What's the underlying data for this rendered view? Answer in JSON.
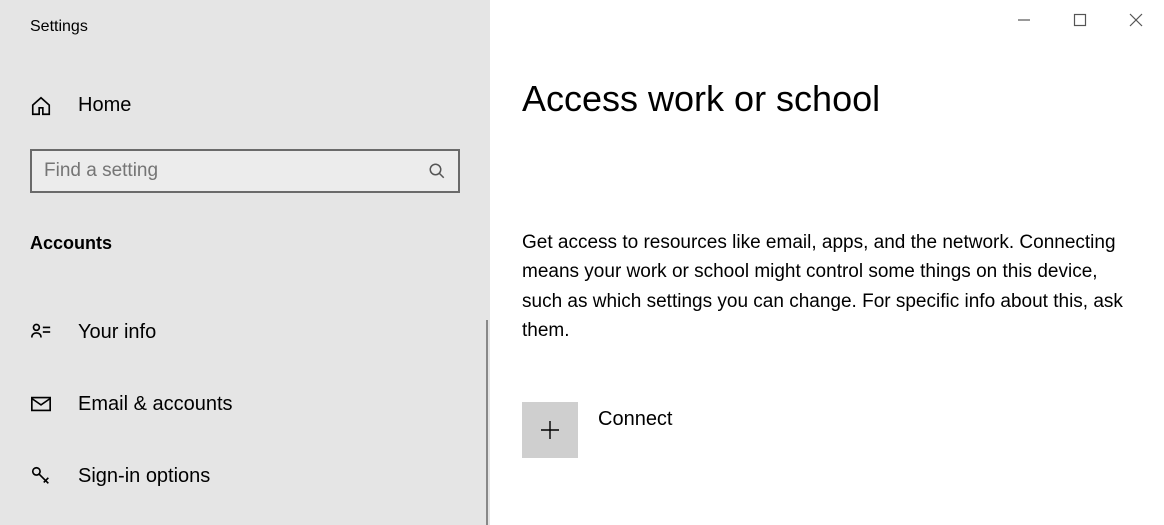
{
  "window": {
    "title": "Settings"
  },
  "sidebar": {
    "home_label": "Home",
    "search_placeholder": "Find a setting",
    "section_heading": "Accounts",
    "items": [
      {
        "label": "Your info"
      },
      {
        "label": "Email & accounts"
      },
      {
        "label": "Sign-in options"
      }
    ]
  },
  "main": {
    "title": "Access work or school",
    "description": "Get access to resources like email, apps, and the network. Connecting means your work or school might control some things on this device, such as which settings you can change. For specific info about this, ask them.",
    "connect_label": "Connect"
  }
}
